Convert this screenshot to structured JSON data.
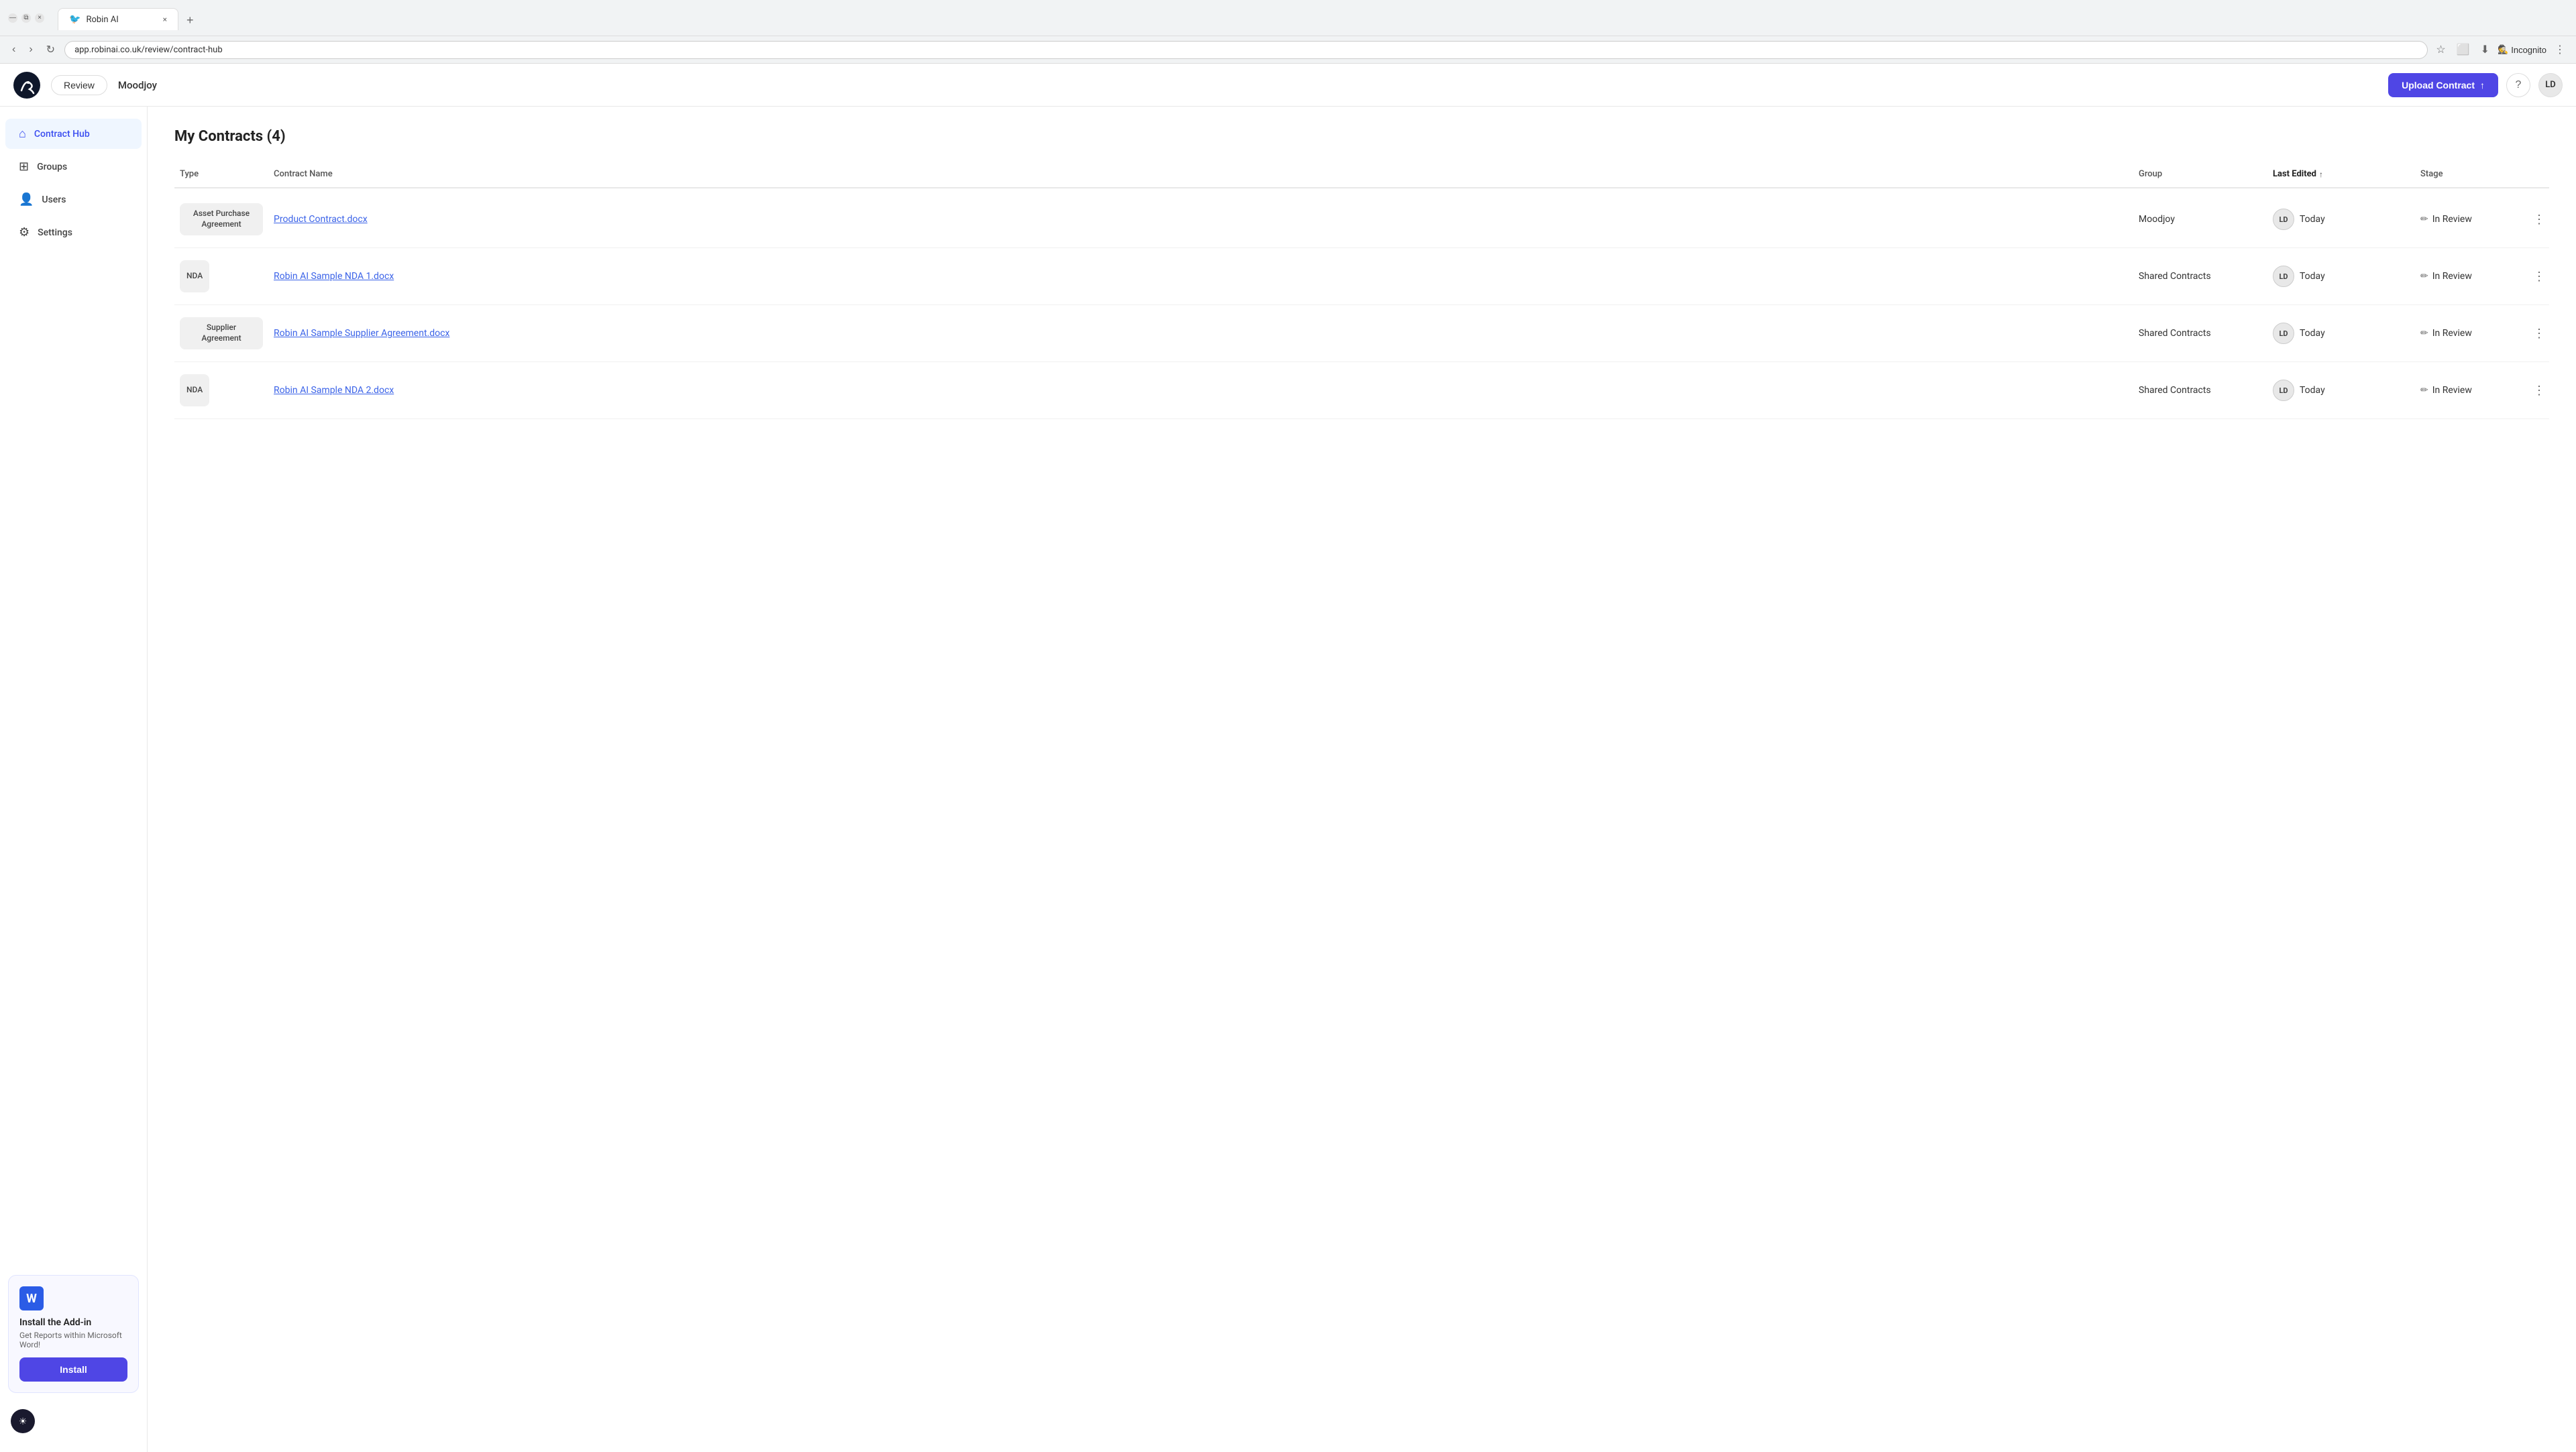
{
  "browser": {
    "tab_label": "Robin AI",
    "tab_close": "×",
    "new_tab": "+",
    "nav_back": "‹",
    "nav_forward": "›",
    "nav_reload": "↻",
    "url": "app.robinai.co.uk/review/contract-hub",
    "bookmark_icon": "☆",
    "extensions_icon": "⬜",
    "download_icon": "⬇",
    "incognito_label": "Incognito",
    "menu_icon": "⋮",
    "window_minimize": "—",
    "window_restore": "⧉",
    "window_close": "×"
  },
  "header": {
    "logo_alt": "Robin AI bird logo",
    "review_btn": "Review",
    "company": "Moodjoy",
    "upload_btn": "Upload Contract",
    "help_icon": "?",
    "user_initials": "LD"
  },
  "sidebar": {
    "items": [
      {
        "id": "contract-hub",
        "label": "Contract Hub",
        "icon": "⌂",
        "active": true
      },
      {
        "id": "groups",
        "label": "Groups",
        "icon": "⊞",
        "active": false
      },
      {
        "id": "users",
        "label": "Users",
        "icon": "👤",
        "active": false
      },
      {
        "id": "settings",
        "label": "Settings",
        "icon": "⚙",
        "active": false
      }
    ],
    "addon": {
      "icon": "W",
      "title": "Install the Add-in",
      "description": "Get Reports within Microsoft Word!",
      "install_btn": "Install"
    },
    "bottom_icon": "☀"
  },
  "main": {
    "page_title": "My Contracts (4)",
    "table": {
      "columns": [
        "Type",
        "Contract Name",
        "Group",
        "Last Edited",
        "Stage"
      ],
      "sorted_col": "Last Edited",
      "sort_dir": "↑",
      "rows": [
        {
          "type": "Asset Purchase Agreement",
          "contract_name": "Product Contract.docx",
          "group": "Moodjoy",
          "avatar_initials": "LD",
          "last_edited": "Today",
          "stage": "In Review"
        },
        {
          "type": "NDA",
          "contract_name": "Robin AI Sample NDA 1.docx",
          "group": "Shared Contracts",
          "avatar_initials": "LD",
          "last_edited": "Today",
          "stage": "In Review"
        },
        {
          "type": "Supplier Agreement",
          "contract_name": "Robin AI Sample Supplier Agreement.docx",
          "group": "Shared Contracts",
          "avatar_initials": "LD",
          "last_edited": "Today",
          "stage": "In Review"
        },
        {
          "type": "NDA",
          "contract_name": "Robin AI Sample NDA 2.docx",
          "group": "Shared Contracts",
          "avatar_initials": "LD",
          "last_edited": "Today",
          "stage": "In Review"
        }
      ]
    }
  }
}
